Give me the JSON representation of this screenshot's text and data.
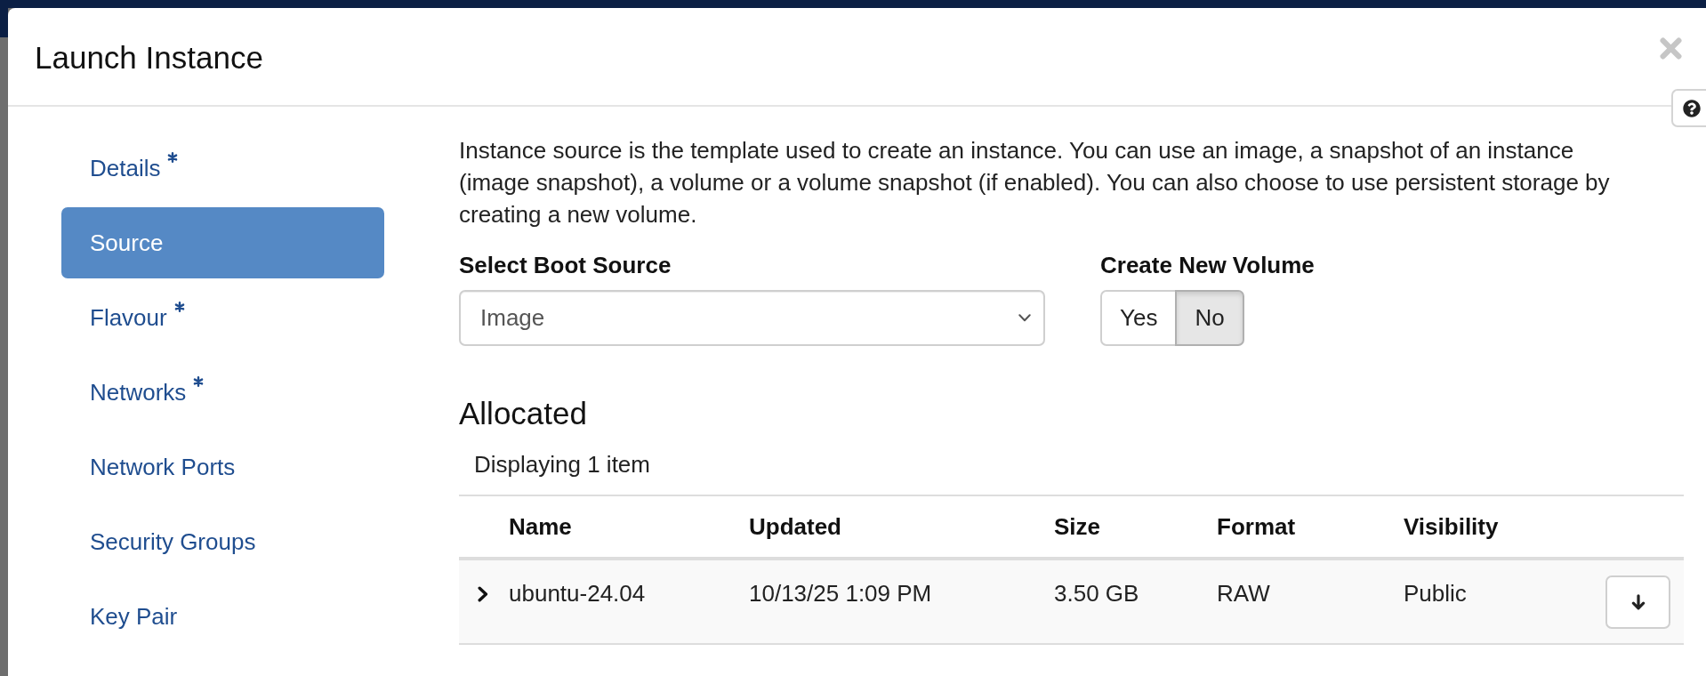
{
  "modal": {
    "title": "Launch Instance"
  },
  "sidebar": {
    "items": [
      {
        "label": "Details",
        "required": true,
        "selected": false
      },
      {
        "label": "Source",
        "required": false,
        "selected": true
      },
      {
        "label": "Flavour",
        "required": true,
        "selected": false
      },
      {
        "label": "Networks",
        "required": true,
        "selected": false
      },
      {
        "label": "Network Ports",
        "required": false,
        "selected": false
      },
      {
        "label": "Security Groups",
        "required": false,
        "selected": false
      },
      {
        "label": "Key Pair",
        "required": false,
        "selected": false
      }
    ]
  },
  "source": {
    "description": "Instance source is the template used to create an instance. You can use an image, a snapshot of an instance (image snapshot), a volume or a volume snapshot (if enabled). You can also choose to use persistent storage by creating a new volume.",
    "boot_source": {
      "label": "Select Boot Source",
      "value": "Image"
    },
    "create_new_volume": {
      "label": "Create New Volume",
      "options": [
        {
          "label": "Yes",
          "selected": false
        },
        {
          "label": "No",
          "selected": true
        }
      ]
    }
  },
  "allocated": {
    "title": "Allocated",
    "summary": "Displaying 1 item",
    "table": {
      "columns": [
        "Name",
        "Updated",
        "Size",
        "Format",
        "Visibility"
      ],
      "rows": [
        {
          "expanded": false,
          "cells": [
            "ubuntu-24.04",
            "10/13/25 1:09 PM",
            "3.50 GB",
            "RAW",
            "Public"
          ]
        }
      ]
    }
  }
}
